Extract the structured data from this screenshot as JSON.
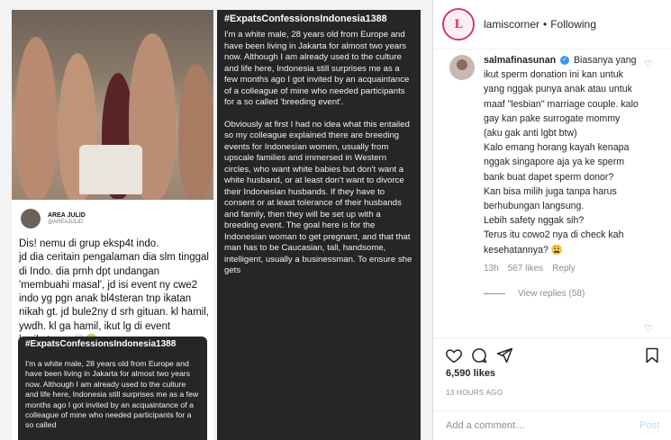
{
  "post": {
    "tweet": {
      "name": "AREA JULID",
      "handle": "@AREAJULID",
      "text": "Dis! nemu di grup eksp4t indo.\njd dia ceritain pengalaman dia slm tinggal di Indo. dia prnh dpt undangan 'membuahi masal', jd isi event ny cwe2 indo yg pgn anak bl4steran tnp ikatan nikah gt. jd bule2ny d srh gituan. kl hamil, ywdh. kl ga hamil, ikut lg di event berikutnya. 💀🤢"
    },
    "confession_small": {
      "title": "#ExpatsConfessionsIndonesia1388",
      "text": "I'm a white male, 28 years old from Europe and have been living in Jakarta for almost two years now. Although I am already used to the culture and life here, Indonesia still surprises me as a few months ago I got invited by an acquaintance of a colleague of mine who needed participants for a so called"
    },
    "confession_big": {
      "title": "#ExpatsConfessionsIndonesia1388",
      "p1": "I'm a white male, 28 years old from Europe and have been living in Jakarta for almost two years now. Although I am already used to the culture and life here, Indonesia still surprises me as a few months ago I got invited by an acquaintance of a colleague of mine who needed participants for a so called 'breeding event'.",
      "p2": "Obviously at first I had no idea what this entailed so my colleague explained there are breeding events for Indonesian women, usually from upscale families and immersed in Western circles, who want white babies but don't want a white husband, or at least don't want to divorce their Indonesian husbands. If they have to consent or at least tolerance of their husbands and family, then they will be set up with a breeding event. The goal here is for the Indonesian woman to get pregnant, and that that man has to be Caucasian, tall, handsome, intelligent, usually a businessman. To ensure she gets"
    }
  },
  "header": {
    "username": "lamiscorner",
    "separator": "•",
    "follow_status": "Following"
  },
  "comment": {
    "username": "salmafinasunan",
    "lines": [
      "Biasanya yang ikut sperm donation ini kan untuk yang nggak punya anak atau untuk maaf \"lesbian\" marriage couple. kalo gay kan pake surrogate mommy (aku gak anti lgbt btw)",
      "Kalo emang horang kayah kenapa nggak singapore aja ya ke sperm bank buat dapet sperm donor?",
      "Kan bisa milih juga tanpa harus berhubungan langsung.",
      "Lebih safety nggak sih?",
      "Terus itu cowo2 nya di check kah kesehatannya? 😩"
    ],
    "time": "13h",
    "likes": "567 likes",
    "reply_label": "Reply",
    "view_replies": "View replies (58)"
  },
  "stats": {
    "likes": "6,590 likes",
    "time_ago": "13 HOURS AGO"
  },
  "composer": {
    "placeholder": "Add a comment…",
    "post_label": "Post"
  }
}
